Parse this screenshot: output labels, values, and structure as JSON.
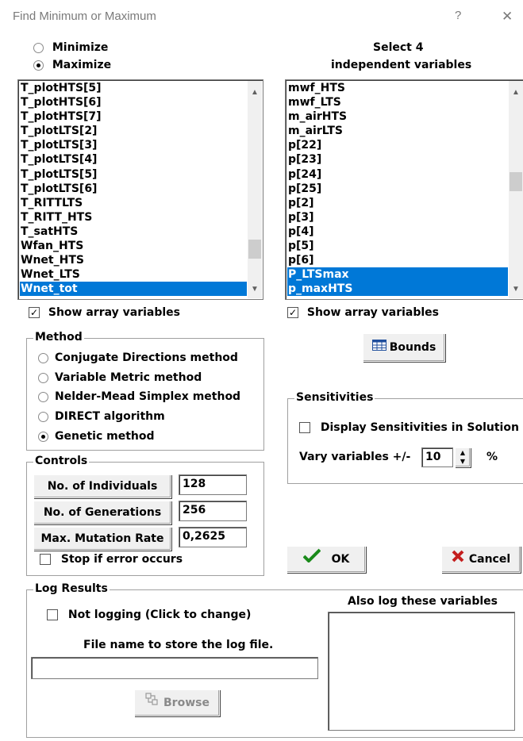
{
  "window": {
    "title": "Find Minimum or Maximum",
    "help_glyph": "?",
    "close_glyph": "✕"
  },
  "mode": {
    "minimize_label": "Minimize",
    "maximize_label": "Maximize",
    "selected": "Maximize"
  },
  "select_header": {
    "line1": "Select 4",
    "line2": "independent variables"
  },
  "left_list": {
    "items": [
      "T_plotHTS[5]",
      "T_plotHTS[6]",
      "T_plotHTS[7]",
      "T_plotLTS[2]",
      "T_plotLTS[3]",
      "T_plotLTS[4]",
      "T_plotLTS[5]",
      "T_plotLTS[6]",
      "T_RITTLTS",
      "T_RITT_HTS",
      "T_satHTS",
      "Wfan_HTS",
      "Wnet_HTS",
      "Wnet_LTS",
      "Wnet_tot"
    ],
    "selected": [
      "Wnet_tot"
    ],
    "show_array_label": "Show array variables",
    "show_array_checked": true
  },
  "right_list": {
    "items": [
      "mwf_HTS",
      "mwf_LTS",
      "m_airHTS",
      "m_airLTS",
      "p[22]",
      "p[23]",
      "p[24]",
      "p[25]",
      "p[2]",
      "p[3]",
      "p[4]",
      "p[5]",
      "p[6]",
      "P_LTSmax",
      "p_maxHTS"
    ],
    "selected": [
      "P_LTSmax",
      "p_maxHTS"
    ],
    "show_array_label": "Show array variables",
    "show_array_checked": true
  },
  "method": {
    "legend": "Method",
    "options": [
      "Conjugate Directions method",
      "Variable Metric method",
      "Nelder-Mead Simplex method",
      "DIRECT algorithm",
      "Genetic method"
    ],
    "selected": "Genetic method"
  },
  "bounds_button": "Bounds",
  "sensitivities": {
    "legend": "Sensitivities",
    "display_label": "Display Sensitivities in Solution",
    "display_checked": false,
    "vary_label": "Vary variables +/-",
    "vary_value": "10",
    "vary_unit": "%"
  },
  "controls": {
    "legend": "Controls",
    "individuals_label": "No. of Individuals",
    "individuals_value": "128",
    "generations_label": "No. of Generations",
    "generations_value": "256",
    "mutation_label": "Max. Mutation Rate",
    "mutation_value": "0,2625",
    "stop_label": "Stop if error occurs",
    "stop_checked": false
  },
  "ok_label": "OK",
  "cancel_label": "Cancel",
  "log": {
    "legend": "Log Results",
    "not_logging_label": "Not logging (Click to change)",
    "not_logging_checked": false,
    "file_label": "File name to store the log file.",
    "file_value": "",
    "browse_label": "Browse",
    "also_log_label": "Also log these variables"
  }
}
